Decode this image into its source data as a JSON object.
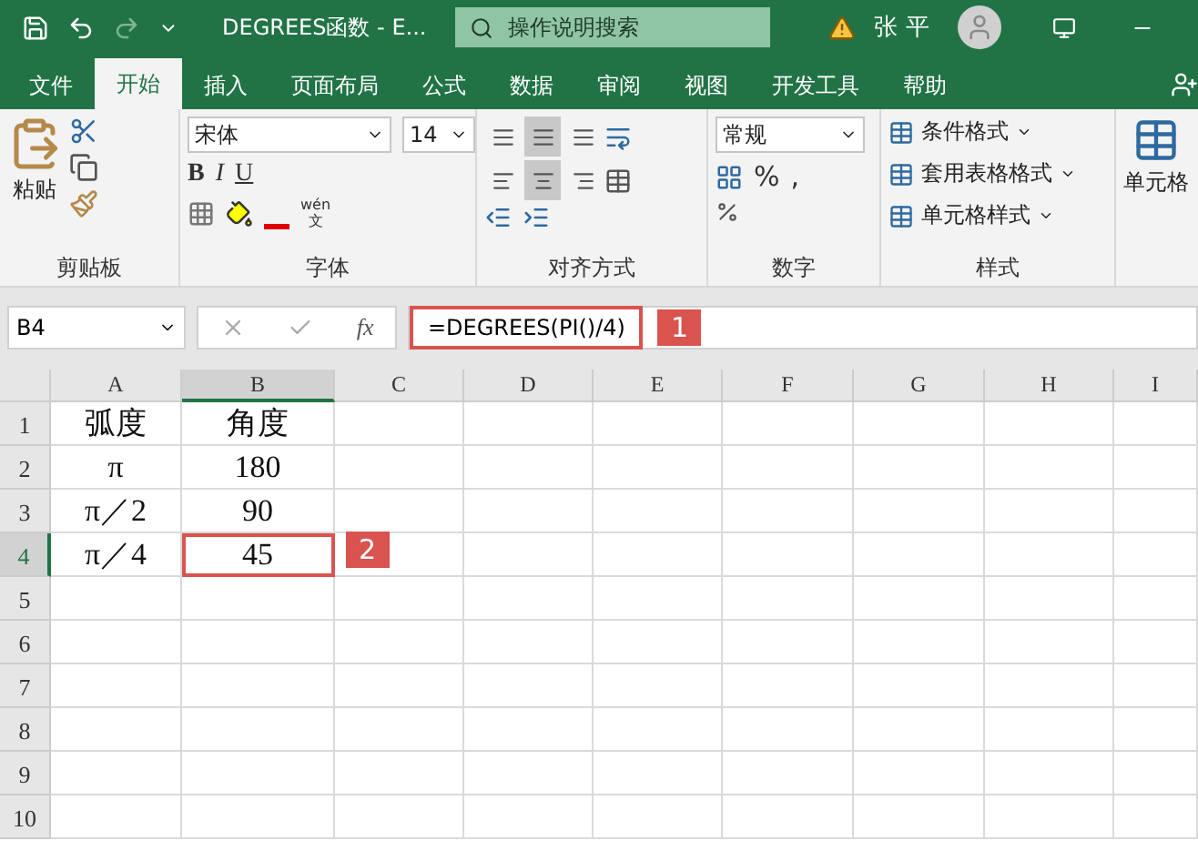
{
  "title_bar": {
    "title": "DEGREES函数  -  E...",
    "search": {
      "placeholder": "操作说明搜索"
    },
    "user": "张 平"
  },
  "tabs": [
    {
      "label": "文件",
      "selected": false
    },
    {
      "label": "开始",
      "selected": true
    },
    {
      "label": "插入",
      "selected": false
    },
    {
      "label": "页面布局",
      "selected": false
    },
    {
      "label": "公式",
      "selected": false
    },
    {
      "label": "数据",
      "selected": false
    },
    {
      "label": "审阅",
      "selected": false
    },
    {
      "label": "视图",
      "selected": false
    },
    {
      "label": "开发工具",
      "selected": false
    },
    {
      "label": "帮助",
      "selected": false
    }
  ],
  "ribbon": {
    "clipboard": {
      "paste": "粘贴",
      "label": "剪贴板"
    },
    "font": {
      "name": "宋体",
      "size": "14",
      "bold": "B",
      "italic": "I",
      "underline": "U",
      "phonetic_top": "wén",
      "phonetic_bottom": "文",
      "label": "字体"
    },
    "alignment": {
      "top_row": [
        {
          "selected": false
        },
        {
          "selected": true
        },
        {
          "selected": false
        }
      ],
      "middle_row": [
        {
          "selected": false
        },
        {
          "selected": true
        },
        {
          "selected": false
        }
      ],
      "label": "对齐方式"
    },
    "number": {
      "format": "常规",
      "percent": "%",
      "comma": ",",
      "label": "数字"
    },
    "styles": {
      "items": [
        "条件格式",
        "套用表格格式",
        "单元格样式"
      ],
      "label": "样式"
    },
    "cells": {
      "label": "单元格"
    }
  },
  "formula_bar": {
    "name_box": "B4",
    "fx": "fx",
    "formula": "=DEGREES(PI()/4)",
    "callout": "1"
  },
  "sheet": {
    "columns": [
      {
        "label": "A",
        "selected": false
      },
      {
        "label": "B",
        "selected": true
      },
      {
        "label": "C",
        "selected": false
      },
      {
        "label": "D",
        "selected": false
      },
      {
        "label": "E",
        "selected": false
      },
      {
        "label": "F",
        "selected": false
      },
      {
        "label": "G",
        "selected": false
      },
      {
        "label": "H",
        "selected": false
      },
      {
        "label": "I",
        "selected": false
      }
    ],
    "rows": [
      {
        "label": "1",
        "selected": false,
        "cells": [
          {
            "text": "弧度",
            "selected": false
          },
          {
            "text": "角度",
            "selected": false
          }
        ]
      },
      {
        "label": "2",
        "selected": false,
        "cells": [
          {
            "text": "π",
            "selected": false
          },
          {
            "text": "180",
            "selected": false
          }
        ]
      },
      {
        "label": "3",
        "selected": false,
        "cells": [
          {
            "text": "π／2",
            "selected": false
          },
          {
            "text": "90",
            "selected": false
          }
        ]
      },
      {
        "label": "4",
        "selected": true,
        "cells": [
          {
            "text": "π／4",
            "selected": false
          },
          {
            "text": "45",
            "selected": true
          }
        ]
      },
      {
        "label": "5",
        "selected": false
      },
      {
        "label": "6",
        "selected": false
      },
      {
        "label": "7",
        "selected": false
      },
      {
        "label": "8",
        "selected": false
      },
      {
        "label": "9",
        "selected": false
      },
      {
        "label": "10",
        "selected": false
      }
    ],
    "callout": "2"
  }
}
